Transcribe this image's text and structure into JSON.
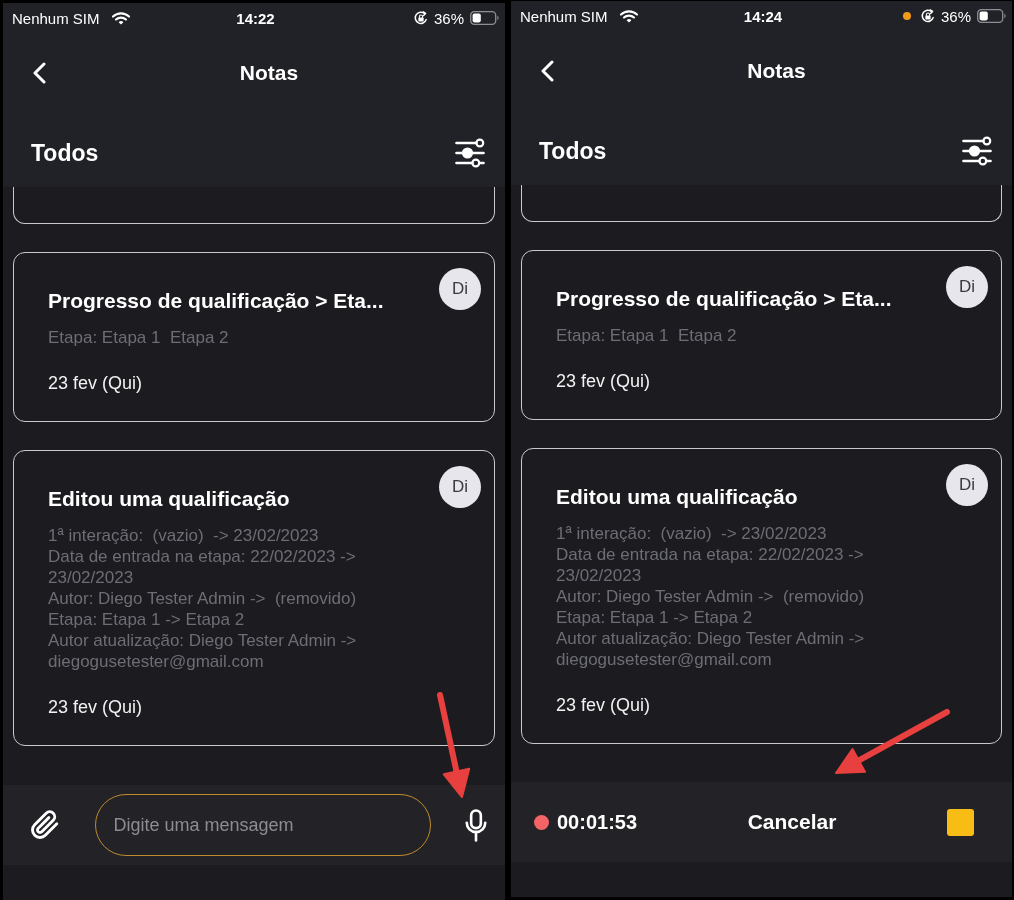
{
  "screens": [
    {
      "status_bar": {
        "carrier": "Nenhum SIM",
        "time": "14:22",
        "battery": "36%"
      },
      "nav": {
        "title": "Notas"
      },
      "filter": {
        "label": "Todos"
      },
      "notes_clipped_above": true,
      "notes": [
        {
          "title": "Progresso de qualificação > Eta...",
          "author_initials": "Di",
          "details": [
            "Etapa: Etapa 1  Etapa 2"
          ],
          "date": "23 fev (Qui)"
        },
        {
          "title": "Editou uma qualificação",
          "author_initials": "Di",
          "details": [
            "1ª interação:  (vazio)  -> 23/02/2023",
            "Data de entrada na etapa: 22/02/2023 -> 23/02/2023",
            "Autor: Diego Tester Admin ->  (removido)",
            "Etapa: Etapa 1 -> Etapa 2",
            "Autor atualização: Diego Tester Admin -> diegogusetester@gmail.com"
          ],
          "date": "23 fev (Qui)"
        }
      ],
      "composer": {
        "kind": "input",
        "placeholder": "Digite uma mensagem"
      },
      "annotation": {
        "kind": "arrow-down"
      }
    },
    {
      "status_bar": {
        "carrier": "Nenhum SIM",
        "time": "14:24",
        "mic_indicator": true,
        "battery": "36%"
      },
      "nav": {
        "title": "Notas"
      },
      "filter": {
        "label": "Todos"
      },
      "notes_clipped_above": true,
      "notes": [
        {
          "title": "Progresso de qualificação > Eta...",
          "author_initials": "Di",
          "details": [
            "Etapa: Etapa 1  Etapa 2"
          ],
          "date": "23 fev (Qui)"
        },
        {
          "title": "Editou uma qualificação",
          "author_initials": "Di",
          "details": [
            "1ª interação:  (vazio)  -> 23/02/2023",
            "Data de entrada na etapa: 22/02/2023 -> 23/02/2023",
            "Autor: Diego Tester Admin ->  (removido)",
            "Etapa: Etapa 1 -> Etapa 2",
            "Autor atualização: Diego Tester Admin -> diegogusetester@gmail.com"
          ],
          "date": "23 fev (Qui)"
        }
      ],
      "composer": {
        "kind": "recording",
        "timer": "00:01:53",
        "cancel": "Cancelar"
      },
      "annotation": {
        "kind": "arrow-down-left"
      }
    }
  ]
}
